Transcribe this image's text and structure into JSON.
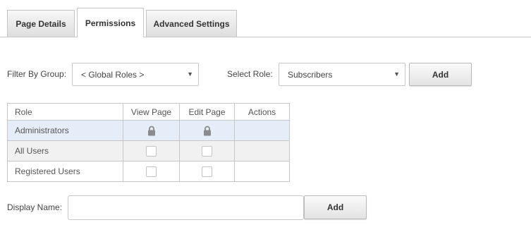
{
  "tabs": [
    {
      "label": "Page Details",
      "active": false
    },
    {
      "label": "Permissions",
      "active": true
    },
    {
      "label": "Advanced Settings",
      "active": false
    }
  ],
  "filter": {
    "label": "Filter By Group:",
    "value": "< Global Roles >"
  },
  "role_select": {
    "label": "Select Role:",
    "value": "Subscribers",
    "add_label": "Add"
  },
  "permissions_table": {
    "columns": [
      "Role",
      "View Page",
      "Edit Page",
      "Actions"
    ],
    "rows": [
      {
        "role": "Administrators",
        "view": "locked",
        "edit": "locked",
        "selected": true
      },
      {
        "role": "All Users",
        "view": "unchecked",
        "edit": "unchecked",
        "selected": false
      },
      {
        "role": "Registered Users",
        "view": "unchecked",
        "edit": "unchecked",
        "selected": false
      }
    ]
  },
  "display_name": {
    "label": "Display Name:",
    "value": "",
    "add_label": "Add"
  },
  "icons": {
    "lock": "lock-icon",
    "dropdown": "caret-down-icon"
  },
  "colors": {
    "selected_row": "#e5eef8",
    "alt_row": "#f1f1f1",
    "border": "#c6c6c6"
  }
}
